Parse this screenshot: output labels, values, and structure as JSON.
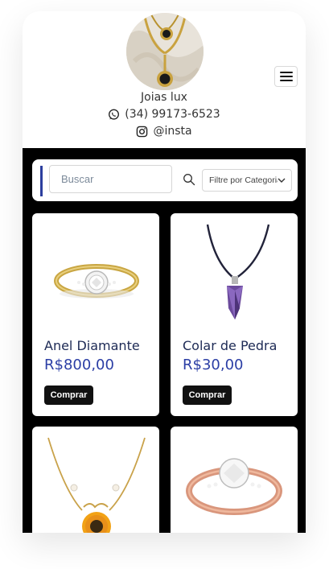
{
  "header": {
    "brand": "Joias lux",
    "phone": "(34) 99173-6523",
    "instagram": "@insta",
    "avatar_icon": "jewelry-necklace-photo",
    "phone_icon": "whatsapp-icon",
    "instagram_icon": "instagram-icon",
    "menu_icon": "hamburger-menu-icon"
  },
  "search": {
    "placeholder": "Buscar",
    "filter_label": "Filtre por Categoria",
    "accent_color": "#2c3e9e"
  },
  "products": [
    {
      "title": "Anel Diamante",
      "price": "R$800,00",
      "button": "Comprar",
      "image_icon": "diamond-ring"
    },
    {
      "title": "Colar de Pedra",
      "price": "R$30,00",
      "button": "Comprar",
      "image_icon": "amethyst-pendant-necklace"
    },
    {
      "title": "",
      "price": "",
      "button": "",
      "image_icon": "sunflower-necklace"
    },
    {
      "title": "",
      "price": "",
      "button": "",
      "image_icon": "rose-gold-solitaire-ring"
    }
  ],
  "colors": {
    "content_background": "#000000",
    "price": "#2b3ea5",
    "title": "#1d2a55",
    "button": "#111111"
  }
}
